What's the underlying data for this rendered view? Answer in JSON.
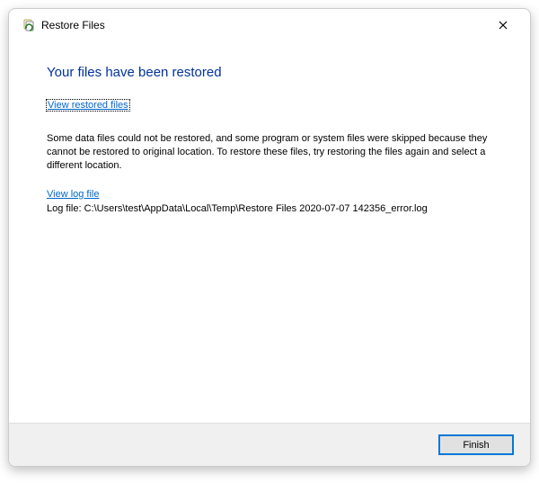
{
  "titlebar": {
    "title": "Restore Files"
  },
  "content": {
    "heading": "Your files have been restored",
    "view_restored_link": "View restored files",
    "description": "Some data files could not be restored, and some program or system files were skipped because they cannot be restored to original location. To restore these files, try restoring the files again and select a different location.",
    "view_log_link": "View log file",
    "log_path": "Log file: C:\\Users\\test\\AppData\\Local\\Temp\\Restore Files 2020-07-07 142356_error.log"
  },
  "footer": {
    "finish_label": "Finish"
  }
}
